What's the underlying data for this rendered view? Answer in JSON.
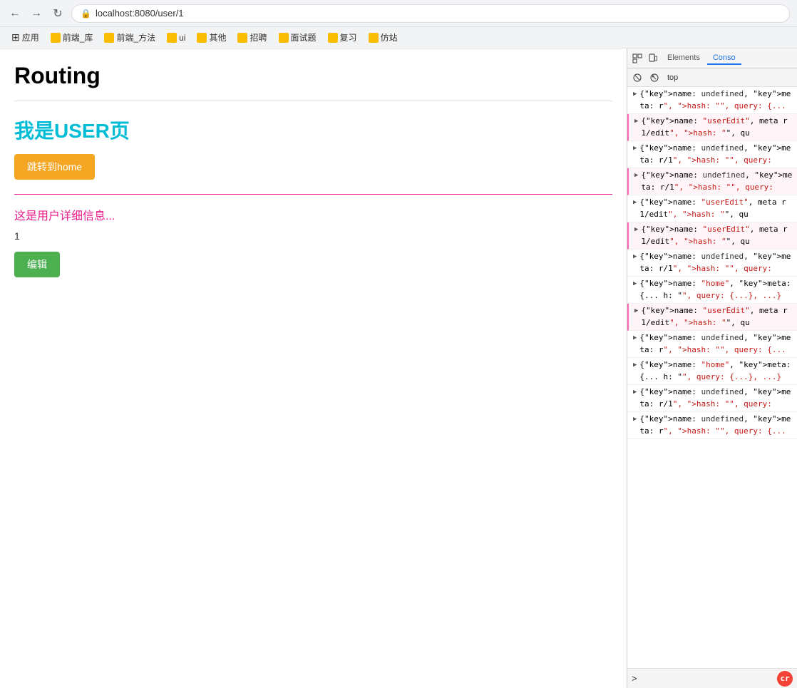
{
  "browser": {
    "url": "localhost:8080/user/1",
    "back_label": "←",
    "forward_label": "→",
    "reload_label": "↻"
  },
  "bookmarks": [
    {
      "label": "应用",
      "color": "#4285f4"
    },
    {
      "label": "前端_库",
      "color": "#fbbc04"
    },
    {
      "label": "前端_方法",
      "color": "#fbbc04"
    },
    {
      "label": "ui",
      "color": "#fbbc04"
    },
    {
      "label": "其他",
      "color": "#fbbc04"
    },
    {
      "label": "招聘",
      "color": "#fbbc04"
    },
    {
      "label": "面试题",
      "color": "#fbbc04"
    },
    {
      "label": "复习",
      "color": "#fbbc04"
    },
    {
      "label": "仿站",
      "color": "#fbbc04"
    }
  ],
  "page": {
    "title": "Routing",
    "user_heading": "我是USER页",
    "btn_home_label": "跳转到home",
    "user_detail": "这是用户详细信息...",
    "user_id": "1",
    "btn_edit_label": "编辑"
  },
  "devtools": {
    "tabs": [
      "Elements",
      "Conso"
    ],
    "active_tab": "Conso",
    "filter_top": "top",
    "log_entries": [
      {
        "highlight": false,
        "text": "{name: undefined, meta: r\", hash: \"\", query: {..."
      },
      {
        "highlight": true,
        "text": "{name: \"userEdit\", meta r1/edit\", hash: \"\", qu"
      },
      {
        "highlight": false,
        "text": "{name: undefined, meta: r/1\", hash: \"\", query:"
      },
      {
        "highlight": true,
        "text": "{name: undefined, meta: r/1\", hash: \"\", query:"
      },
      {
        "highlight": false,
        "text": "{name: \"userEdit\", meta r1/edit\", hash: \"\", qu"
      },
      {
        "highlight": true,
        "text": "{name: \"userEdit\", meta r1/edit\", hash: \"\", qu"
      },
      {
        "highlight": false,
        "text": "{name: undefined, meta: r/1\", hash: \"\", query:"
      },
      {
        "highlight": false,
        "text": "{name: \"home\", meta: {... h: \"\", query: {...}, ...}"
      },
      {
        "highlight": true,
        "text": "{name: \"userEdit\", meta r1/edit\", hash: \"\", qu"
      },
      {
        "highlight": false,
        "text": "{name: undefined, meta: r\", hash: \"\", query: {..."
      },
      {
        "highlight": false,
        "text": "{name: \"home\", meta: {... h: \"\", query: {...}, ...}"
      },
      {
        "highlight": false,
        "text": "{name: undefined, meta: r/1\", hash: \"\", query:"
      },
      {
        "highlight": false,
        "text": "{name: undefined, meta: r\", hash: \"\", query: {..."
      }
    ]
  }
}
